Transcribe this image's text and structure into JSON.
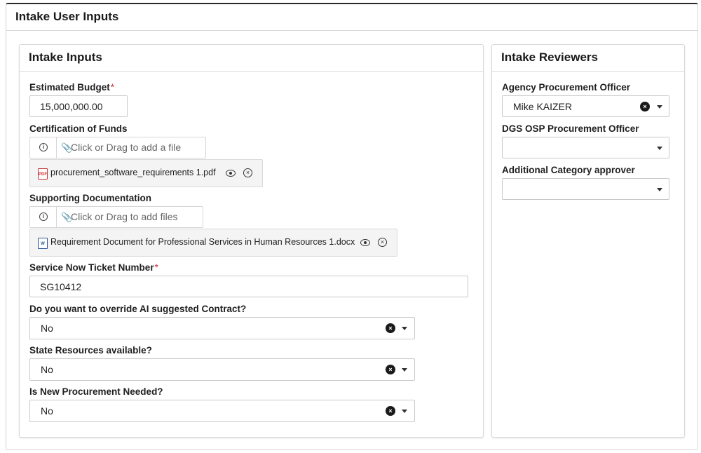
{
  "page": {
    "title": "Intake User Inputs"
  },
  "inputs_card": {
    "title": "Intake Inputs",
    "estimated_budget": {
      "label": "Estimated Budget",
      "required_mark": "*",
      "value": "15,000,000.00"
    },
    "certification_of_funds": {
      "label": "Certification of Funds",
      "upload_text": "Click or Drag to add a file",
      "file": "procurement_software_requirements 1.pdf"
    },
    "supporting_documentation": {
      "label": "Supporting Documentation",
      "upload_text": "Click or Drag to add files",
      "file": "Requirement Document for Professional Services in Human Resources 1.docx"
    },
    "ticket_number": {
      "label": "Service Now Ticket Number",
      "required_mark": "*",
      "value": "SG10412"
    },
    "override_ai": {
      "label": "Do you want to override AI suggested Contract?",
      "value": "No"
    },
    "state_resources": {
      "label": "State Resources available?",
      "value": "No"
    },
    "new_procurement": {
      "label": "Is New Procurement Needed?",
      "value": "No"
    }
  },
  "reviewers_card": {
    "title": "Intake Reviewers",
    "agency_officer": {
      "label": "Agency Procurement Officer",
      "value": "Mike KAIZER"
    },
    "dgs_officer": {
      "label": "DGS OSP Procurement Officer",
      "value": ""
    },
    "category_approver": {
      "label": "Additional Category approver",
      "value": ""
    }
  },
  "icons": {
    "info": "info-icon",
    "clip": "paperclip-icon",
    "pdf": "pdf-file-icon",
    "doc": "word-file-icon",
    "eye": "eye-icon",
    "remove": "remove-circle-icon",
    "clear": "clear-icon",
    "caret": "caret-down-icon"
  },
  "colors": {
    "required": "#d0312d",
    "border": "#c9c9c9"
  }
}
